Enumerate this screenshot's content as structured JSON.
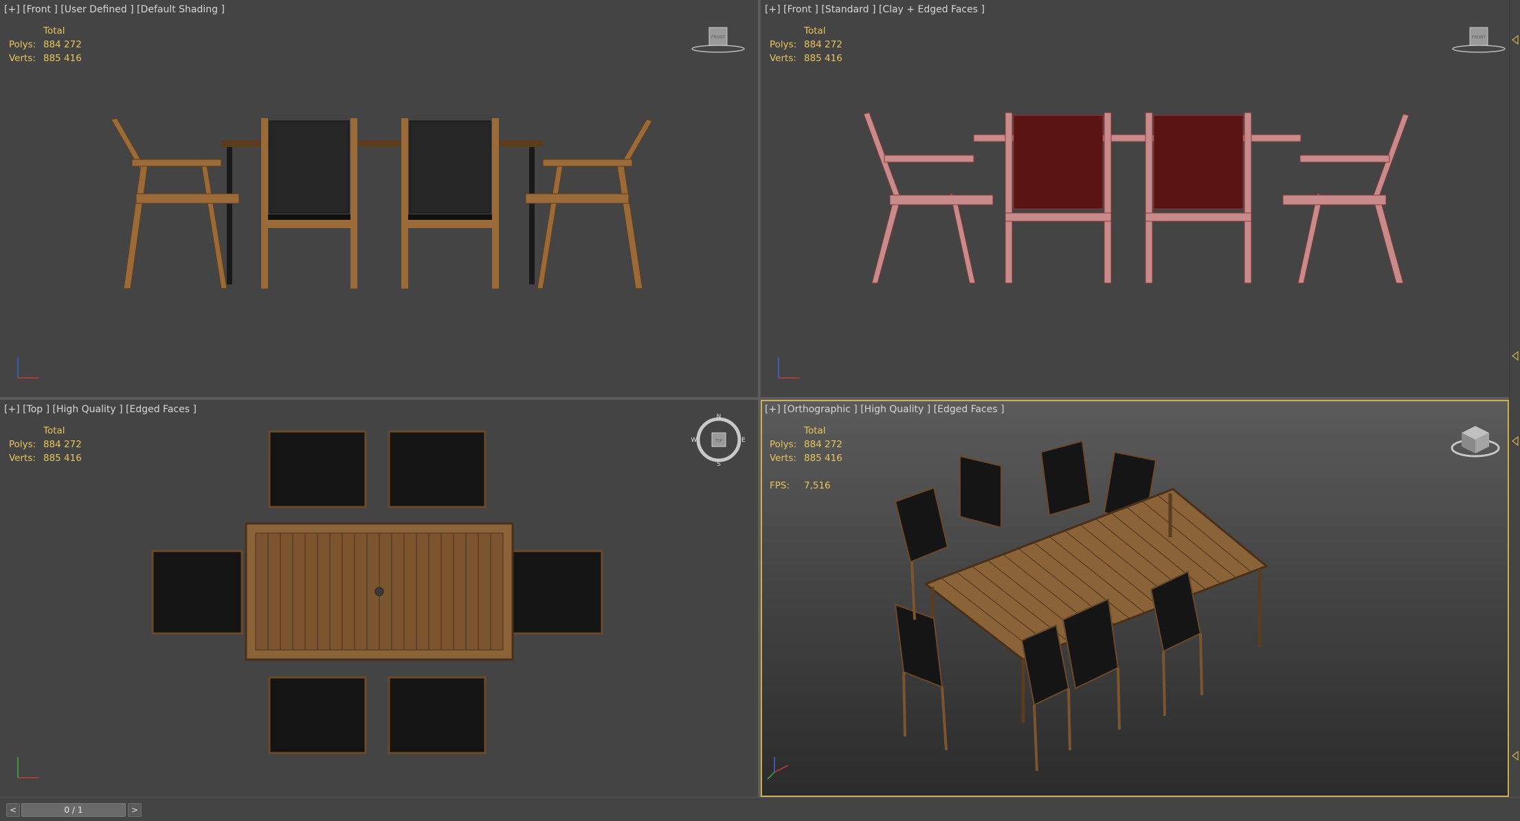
{
  "viewports": [
    {
      "label": "[+] [Front ] [User Defined ] [Default Shading ]",
      "stats": {
        "total_label": "Total",
        "polys_label": "Polys:",
        "polys": "884 272",
        "verts_label": "Verts:",
        "verts": "885 416"
      },
      "viewcube_label": "FRONT"
    },
    {
      "label": "[+] [Front ] [Standard ] [Clay + Edged Faces ]",
      "stats": {
        "total_label": "Total",
        "polys_label": "Polys:",
        "polys": "884 272",
        "verts_label": "Verts:",
        "verts": "885 416"
      },
      "viewcube_label": "FRONT"
    },
    {
      "label": "[+] [Top ] [High Quality ] [Edged Faces ]",
      "stats": {
        "total_label": "Total",
        "polys_label": "Polys:",
        "polys": "884 272",
        "verts_label": "Verts:",
        "verts": "885 416"
      },
      "viewcube_label": "TOP",
      "compass": {
        "n": "N",
        "s": "S",
        "e": "E",
        "w": "W"
      }
    },
    {
      "label": "[+] [Orthographic ] [High Quality ] [Edged Faces ]",
      "stats": {
        "total_label": "Total",
        "polys_label": "Polys:",
        "polys": "884 272",
        "verts_label": "Verts:",
        "verts": "885 416"
      },
      "fps_label": "FPS:",
      "fps": "7,516",
      "active": true
    }
  ],
  "timeline": {
    "prev_label": "<",
    "next_label": ">",
    "frame": "0 / 1"
  },
  "colors": {
    "viewport_bg": "#444444",
    "stats_text": "#e9c55a",
    "active_border": "#d0b04a",
    "wood": "#9a6a38",
    "wicker": "#1e1e1e",
    "clay_wire": "#b46464"
  }
}
